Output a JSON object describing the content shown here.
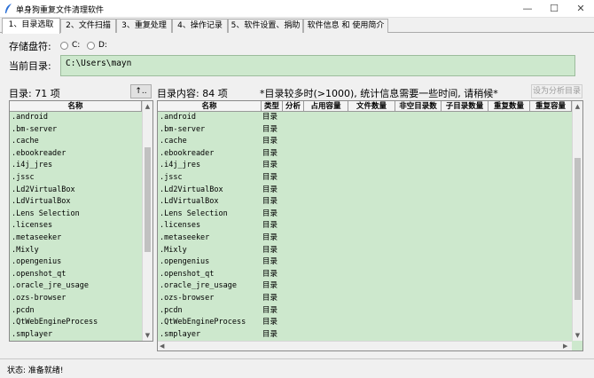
{
  "window": {
    "title": "单身狗重复文件清理软件",
    "minimize": "—",
    "maximize": "☐",
    "close": "✕"
  },
  "tabs": [
    {
      "label": "1、目录选取"
    },
    {
      "label": "2、文件扫描"
    },
    {
      "label": "3、重复处理"
    },
    {
      "label": "4、操作记录"
    },
    {
      "label": "5、软件设置、捐助"
    },
    {
      "label": "软件信息 和 使用简介"
    }
  ],
  "drives": {
    "label": "存储盘符:",
    "options": [
      "C:",
      "D:"
    ]
  },
  "current_dir": {
    "label": "当前目录:",
    "value": "C:\\Users\\mayn"
  },
  "left_panel": {
    "count_label": "目录: 71 项",
    "button_label": "↑..",
    "column": "名称",
    "items": [
      ".android",
      ".bm-server",
      ".cache",
      ".ebookreader",
      ".i4j_jres",
      ".jssc",
      ".Ld2VirtualBox",
      ".LdVirtualBox",
      ".Lens Selection",
      ".licenses",
      ".metaseeker",
      ".Mixly",
      ".opengenius",
      ".openshot_qt",
      ".oracle_jre_usage",
      ".ozs-browser",
      ".pcdn",
      ".QtWebEngineProcess",
      ".smplayer"
    ]
  },
  "right_panel": {
    "count_label": "目录内容: 84 项",
    "notice": "*目录较多时(>1000), 统计信息需要一些时间, 请稍候*",
    "analyze_button": "设为分析目录",
    "columns": [
      "名称",
      "类型",
      "分析",
      "占用容量",
      "文件数量",
      "非空目录数",
      "子目录数量",
      "重复数量",
      "重复容量"
    ],
    "type_value": "目录",
    "items": [
      ".android",
      ".bm-server",
      ".cache",
      ".ebookreader",
      ".i4j_jres",
      ".jssc",
      ".Ld2VirtualBox",
      ".LdVirtualBox",
      ".Lens Selection",
      ".licenses",
      ".metaseeker",
      ".Mixly",
      ".opengenius",
      ".openshot_qt",
      ".oracle_jre_usage",
      ".ozs-browser",
      ".pcdn",
      ".QtWebEngineProcess",
      ".smplayer"
    ]
  },
  "status": {
    "text": "状态: 准备就绪!"
  },
  "colors": {
    "list_bg": "#cde8cd",
    "accent": "#2a6fd6"
  }
}
